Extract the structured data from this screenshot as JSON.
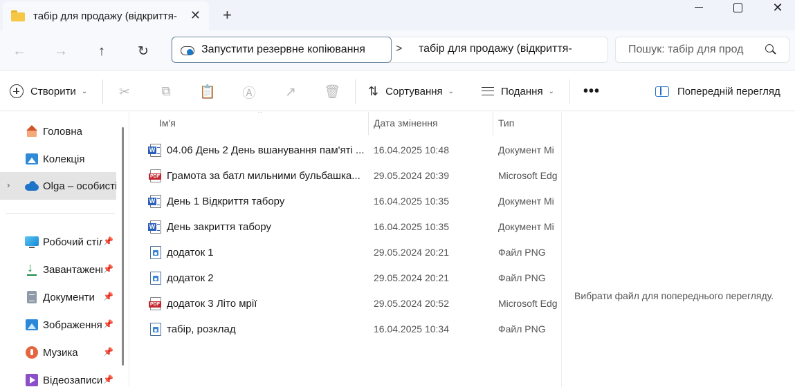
{
  "window": {
    "tab_title": "табір для продажу (відкриття-",
    "tab_close": "✕",
    "new_tab": "+",
    "close": "✕"
  },
  "address": {
    "backup_label": "Запустити резервне копіювання",
    "separator": ">",
    "path": "табір для продажу (відкриття-",
    "search_placeholder": "Пошук: табір для прод"
  },
  "commands": {
    "new_label": "Створити",
    "sort_label": "Сортування",
    "view_label": "Подання",
    "more_label": "•••",
    "preview_label": "Попередній перегляд"
  },
  "sidebar": {
    "items": [
      {
        "label": "Головна",
        "icon": "home-icon"
      },
      {
        "label": "Колекція",
        "icon": "gallery-icon"
      },
      {
        "label": "Olga – особисті",
        "icon": "onedrive-icon",
        "selected": true
      },
      {
        "label": "Робочий стіл",
        "icon": "desktop-icon",
        "pinned": true
      },
      {
        "label": "Завантаження",
        "icon": "downloads-icon",
        "pinned": true
      },
      {
        "label": "Документи",
        "icon": "documents-icon",
        "pinned": true
      },
      {
        "label": "Зображення",
        "icon": "pictures-icon",
        "pinned": true
      },
      {
        "label": "Музика",
        "icon": "music-icon",
        "pinned": true
      },
      {
        "label": "Відеозаписи",
        "icon": "videos-icon",
        "pinned": true
      }
    ]
  },
  "filelist": {
    "columns": {
      "name": "Ім'я",
      "date": "Дата змінення",
      "type": "Тип"
    },
    "files": [
      {
        "name": "04.06 День 2 День вшанування пам'яті ...",
        "date": "16.04.2025 10:48",
        "type": "Документ Mi",
        "kind": "word"
      },
      {
        "name": "Грамота за батл мильними бульбашка...",
        "date": "29.05.2024 20:39",
        "type": "Microsoft Edg",
        "kind": "pdf"
      },
      {
        "name": "День 1 Відкриття табору",
        "date": "16.04.2025 10:35",
        "type": "Документ Mi",
        "kind": "word"
      },
      {
        "name": "День закриття табору",
        "date": "16.04.2025 10:35",
        "type": "Документ Mi",
        "kind": "word"
      },
      {
        "name": "додаток 1",
        "date": "29.05.2024 20:21",
        "type": "Файл PNG",
        "kind": "png"
      },
      {
        "name": "додаток 2",
        "date": "29.05.2024 20:21",
        "type": "Файл PNG",
        "kind": "png"
      },
      {
        "name": "додаток 3 Літо мрії",
        "date": "29.05.2024 20:52",
        "type": "Microsoft Edg",
        "kind": "pdf"
      },
      {
        "name": "табір, розклад",
        "date": "16.04.2025 10:34",
        "type": "Файл PNG",
        "kind": "png"
      }
    ]
  },
  "preview": {
    "message": "Вибрати файл для попереднього перегляду."
  }
}
